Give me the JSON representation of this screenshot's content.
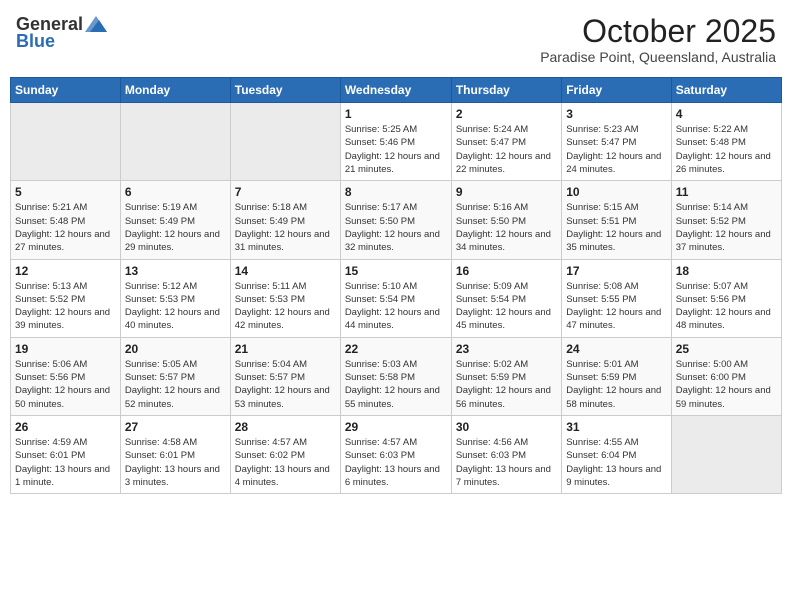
{
  "header": {
    "logo_general": "General",
    "logo_blue": "Blue",
    "month_year": "October 2025",
    "location": "Paradise Point, Queensland, Australia"
  },
  "days_of_week": [
    "Sunday",
    "Monday",
    "Tuesday",
    "Wednesday",
    "Thursday",
    "Friday",
    "Saturday"
  ],
  "weeks": [
    {
      "days": [
        {
          "num": "",
          "empty": true
        },
        {
          "num": "",
          "empty": true
        },
        {
          "num": "",
          "empty": true
        },
        {
          "num": "1",
          "sunrise": "5:25 AM",
          "sunset": "5:46 PM",
          "daylight": "12 hours and 21 minutes."
        },
        {
          "num": "2",
          "sunrise": "5:24 AM",
          "sunset": "5:47 PM",
          "daylight": "12 hours and 22 minutes."
        },
        {
          "num": "3",
          "sunrise": "5:23 AM",
          "sunset": "5:47 PM",
          "daylight": "12 hours and 24 minutes."
        },
        {
          "num": "4",
          "sunrise": "5:22 AM",
          "sunset": "5:48 PM",
          "daylight": "12 hours and 26 minutes."
        }
      ]
    },
    {
      "days": [
        {
          "num": "5",
          "sunrise": "5:21 AM",
          "sunset": "5:48 PM",
          "daylight": "12 hours and 27 minutes."
        },
        {
          "num": "6",
          "sunrise": "5:19 AM",
          "sunset": "5:49 PM",
          "daylight": "12 hours and 29 minutes."
        },
        {
          "num": "7",
          "sunrise": "5:18 AM",
          "sunset": "5:49 PM",
          "daylight": "12 hours and 31 minutes."
        },
        {
          "num": "8",
          "sunrise": "5:17 AM",
          "sunset": "5:50 PM",
          "daylight": "12 hours and 32 minutes."
        },
        {
          "num": "9",
          "sunrise": "5:16 AM",
          "sunset": "5:50 PM",
          "daylight": "12 hours and 34 minutes."
        },
        {
          "num": "10",
          "sunrise": "5:15 AM",
          "sunset": "5:51 PM",
          "daylight": "12 hours and 35 minutes."
        },
        {
          "num": "11",
          "sunrise": "5:14 AM",
          "sunset": "5:52 PM",
          "daylight": "12 hours and 37 minutes."
        }
      ]
    },
    {
      "days": [
        {
          "num": "12",
          "sunrise": "5:13 AM",
          "sunset": "5:52 PM",
          "daylight": "12 hours and 39 minutes."
        },
        {
          "num": "13",
          "sunrise": "5:12 AM",
          "sunset": "5:53 PM",
          "daylight": "12 hours and 40 minutes."
        },
        {
          "num": "14",
          "sunrise": "5:11 AM",
          "sunset": "5:53 PM",
          "daylight": "12 hours and 42 minutes."
        },
        {
          "num": "15",
          "sunrise": "5:10 AM",
          "sunset": "5:54 PM",
          "daylight": "12 hours and 44 minutes."
        },
        {
          "num": "16",
          "sunrise": "5:09 AM",
          "sunset": "5:54 PM",
          "daylight": "12 hours and 45 minutes."
        },
        {
          "num": "17",
          "sunrise": "5:08 AM",
          "sunset": "5:55 PM",
          "daylight": "12 hours and 47 minutes."
        },
        {
          "num": "18",
          "sunrise": "5:07 AM",
          "sunset": "5:56 PM",
          "daylight": "12 hours and 48 minutes."
        }
      ]
    },
    {
      "days": [
        {
          "num": "19",
          "sunrise": "5:06 AM",
          "sunset": "5:56 PM",
          "daylight": "12 hours and 50 minutes."
        },
        {
          "num": "20",
          "sunrise": "5:05 AM",
          "sunset": "5:57 PM",
          "daylight": "12 hours and 52 minutes."
        },
        {
          "num": "21",
          "sunrise": "5:04 AM",
          "sunset": "5:57 PM",
          "daylight": "12 hours and 53 minutes."
        },
        {
          "num": "22",
          "sunrise": "5:03 AM",
          "sunset": "5:58 PM",
          "daylight": "12 hours and 55 minutes."
        },
        {
          "num": "23",
          "sunrise": "5:02 AM",
          "sunset": "5:59 PM",
          "daylight": "12 hours and 56 minutes."
        },
        {
          "num": "24",
          "sunrise": "5:01 AM",
          "sunset": "5:59 PM",
          "daylight": "12 hours and 58 minutes."
        },
        {
          "num": "25",
          "sunrise": "5:00 AM",
          "sunset": "6:00 PM",
          "daylight": "12 hours and 59 minutes."
        }
      ]
    },
    {
      "days": [
        {
          "num": "26",
          "sunrise": "4:59 AM",
          "sunset": "6:01 PM",
          "daylight": "13 hours and 1 minute."
        },
        {
          "num": "27",
          "sunrise": "4:58 AM",
          "sunset": "6:01 PM",
          "daylight": "13 hours and 3 minutes."
        },
        {
          "num": "28",
          "sunrise": "4:57 AM",
          "sunset": "6:02 PM",
          "daylight": "13 hours and 4 minutes."
        },
        {
          "num": "29",
          "sunrise": "4:57 AM",
          "sunset": "6:03 PM",
          "daylight": "13 hours and 6 minutes."
        },
        {
          "num": "30",
          "sunrise": "4:56 AM",
          "sunset": "6:03 PM",
          "daylight": "13 hours and 7 minutes."
        },
        {
          "num": "31",
          "sunrise": "4:55 AM",
          "sunset": "6:04 PM",
          "daylight": "13 hours and 9 minutes."
        },
        {
          "num": "",
          "empty": true
        }
      ]
    }
  ]
}
